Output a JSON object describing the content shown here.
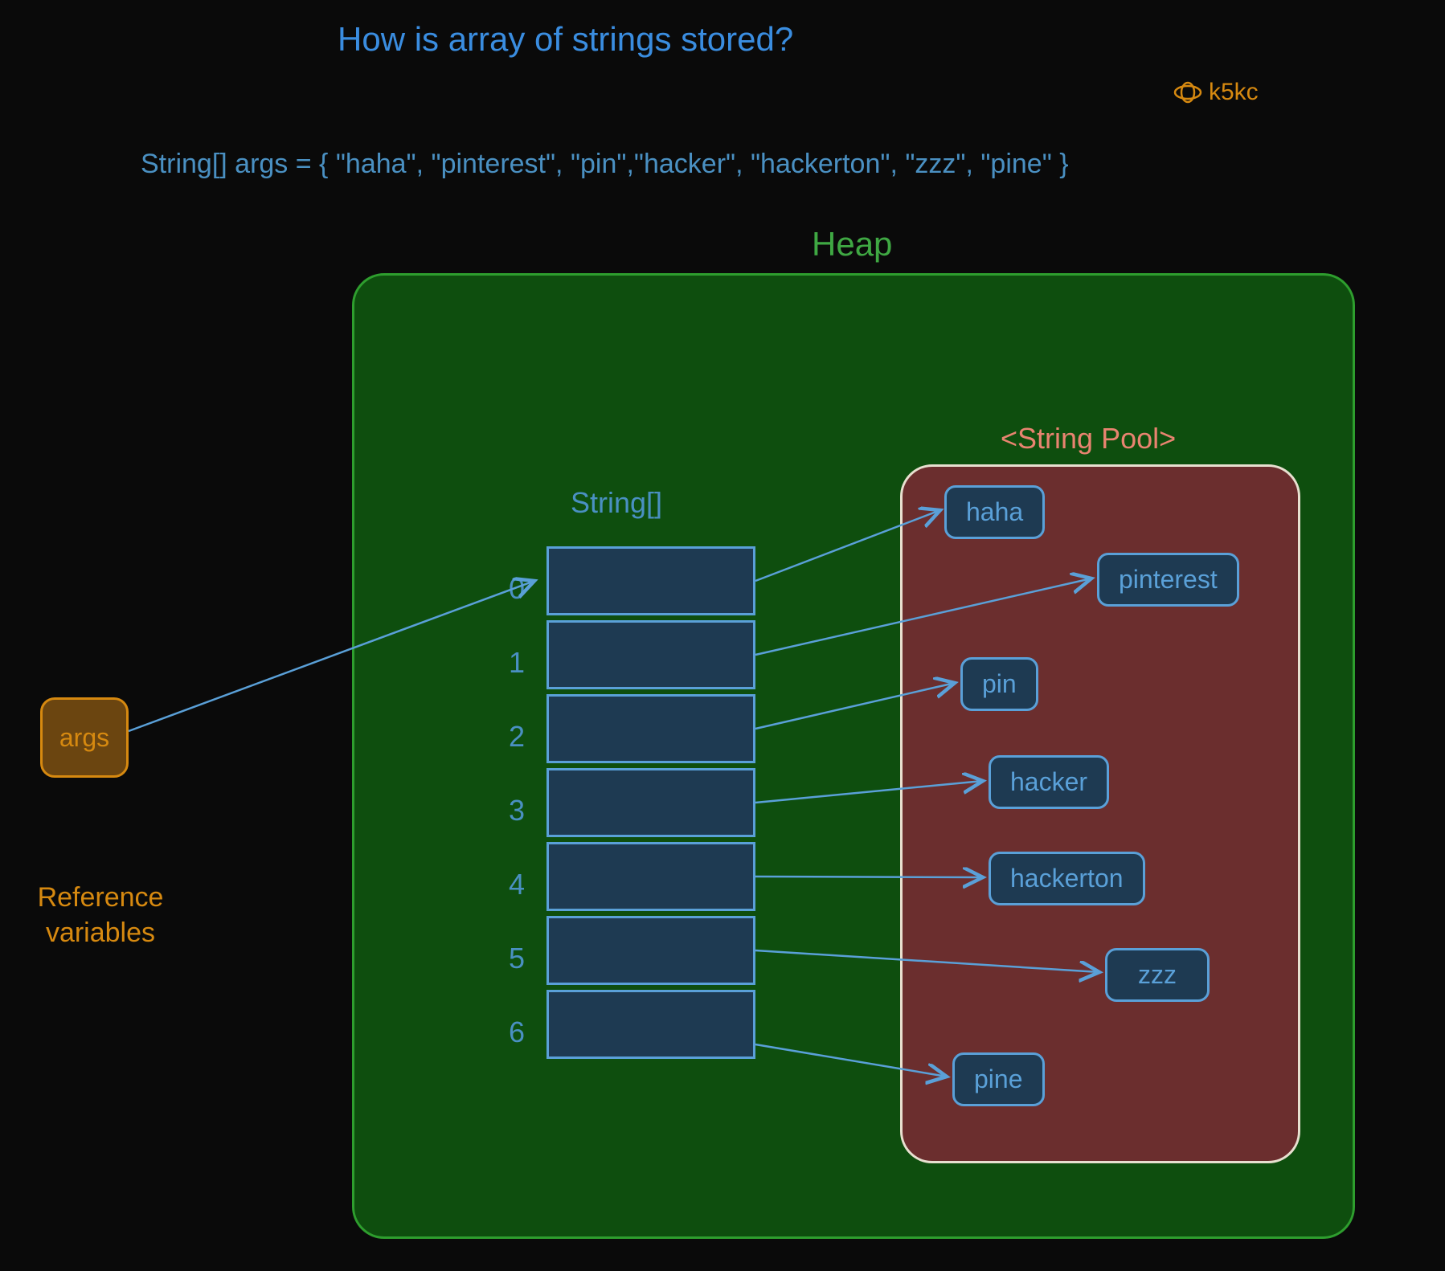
{
  "title": "How is array of strings stored?",
  "watermark": "k5kc",
  "code": "String[] args = { \"haha\", \"pinterest\", \"pin\",\"hacker\", \"hackerton\", \"zzz\", \"pine\" }",
  "heap_label": "Heap",
  "string_pool_label": "<String Pool>",
  "array_type_label": "String[]",
  "array_indices": [
    "0",
    "1",
    "2",
    "3",
    "4",
    "5",
    "6"
  ],
  "pool_items": {
    "haha": "haha",
    "pinterest": "pinterest",
    "pin": "pin",
    "hacker": "hacker",
    "hackerton": "hackerton",
    "zzz": "zzz",
    "pine": "pine"
  },
  "args_var": "args",
  "ref_vars_label": "Reference variables"
}
